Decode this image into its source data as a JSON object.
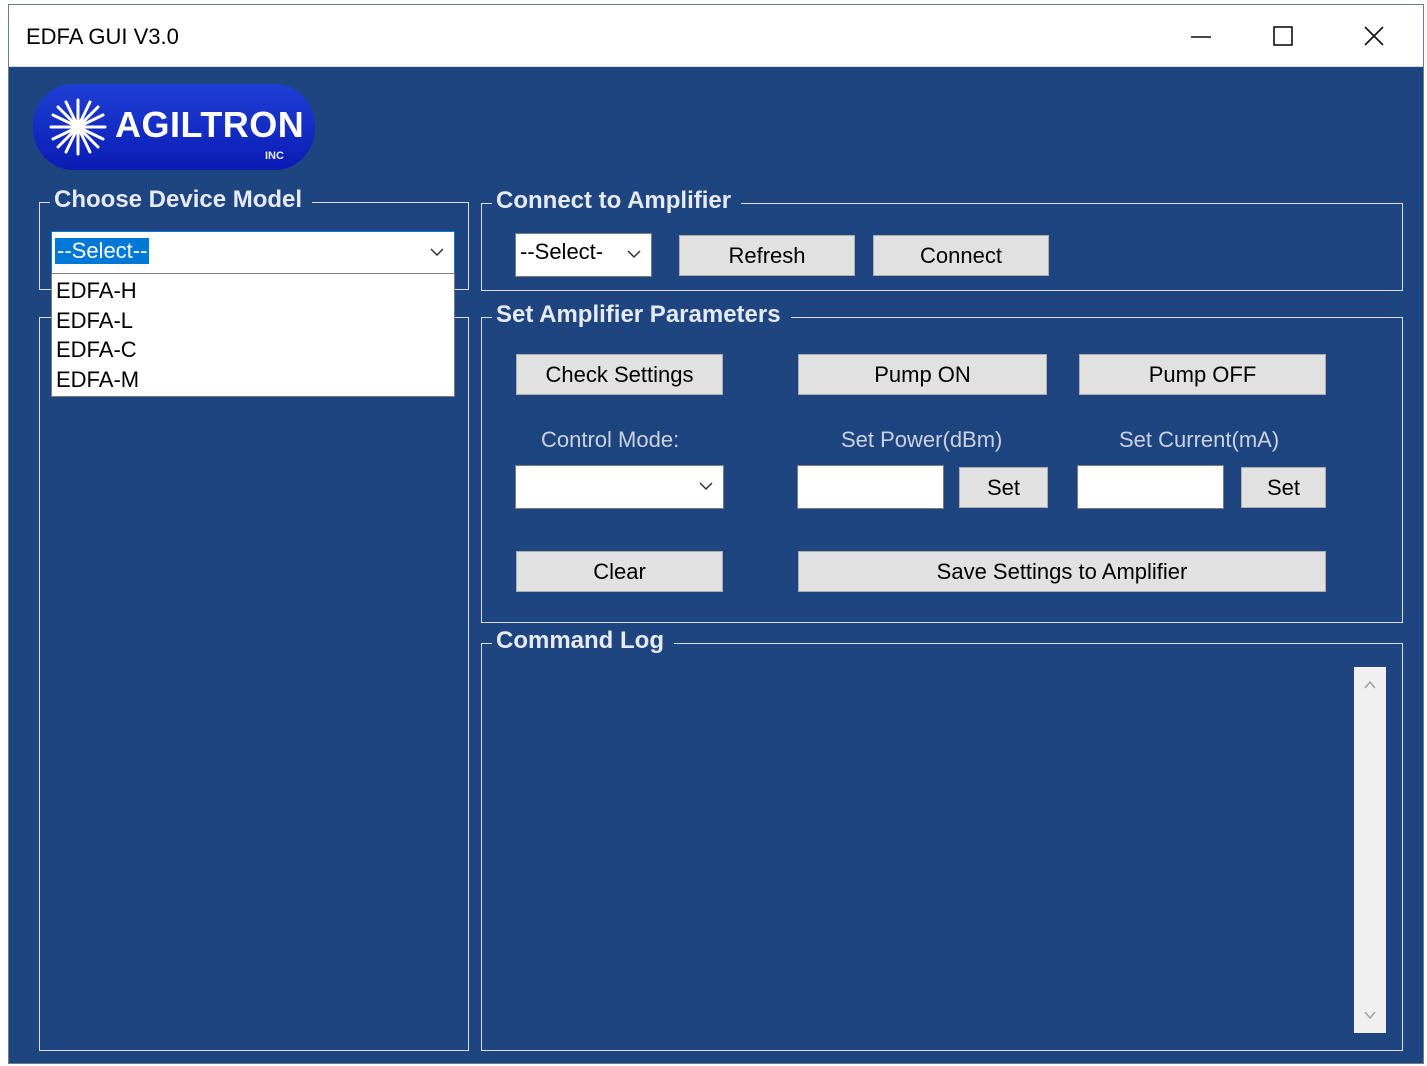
{
  "window": {
    "title": "EDFA GUI V3.0"
  },
  "logo": {
    "text": "AGILTRON",
    "suffix": "INC"
  },
  "device_model": {
    "label": "Choose Device Model",
    "selected": "--Select--",
    "options": [
      "EDFA-H",
      "EDFA-L",
      "EDFA-C",
      "EDFA-M"
    ]
  },
  "connect": {
    "label": "Connect to Amplifier",
    "port_selected": "--Select-",
    "refresh_label": "Refresh",
    "connect_label": "Connect"
  },
  "params": {
    "label": "Set Amplifier Parameters",
    "check_settings_label": "Check Settings",
    "pump_on_label": "Pump ON",
    "pump_off_label": "Pump OFF",
    "control_mode_label": "Control Mode:",
    "control_mode_value": "",
    "set_power_label": "Set Power(dBm)",
    "set_power_value": "",
    "set_current_label": "Set Current(mA)",
    "set_current_value": "",
    "set_label": "Set",
    "clear_label": "Clear",
    "save_label": "Save Settings to Amplifier"
  },
  "log": {
    "label": "Command Log"
  },
  "colors": {
    "background": "#1f4580",
    "logo": "#0a1cb4"
  },
  "icons": [
    "minimize-icon",
    "maximize-icon",
    "close-icon",
    "chevron-down-icon",
    "chevron-up-icon"
  ]
}
